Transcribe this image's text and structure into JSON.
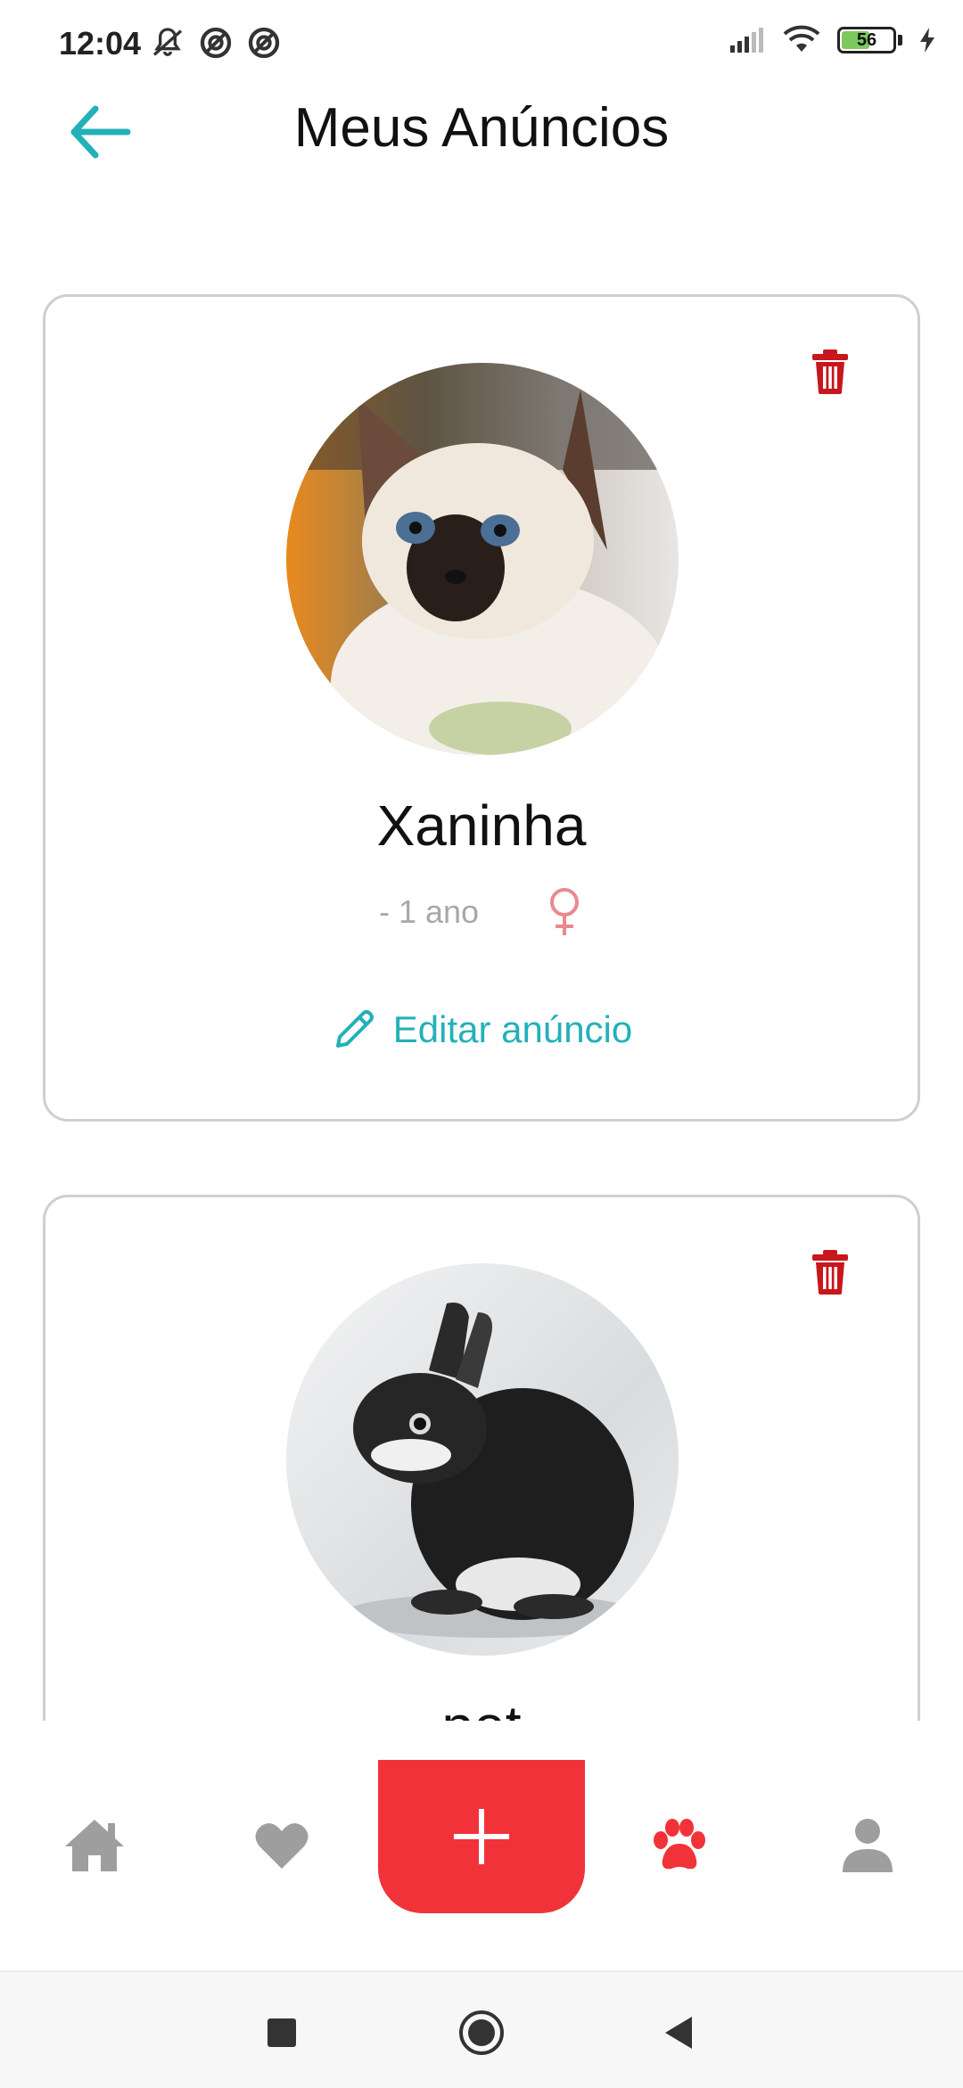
{
  "status_bar": {
    "time": "12:04",
    "battery_level": "56",
    "battery_fraction": 0.56,
    "icons": [
      "muted-bell-icon",
      "do-not-disturb-icon",
      "do-not-disturb-icon",
      "signal-icon",
      "wifi-icon",
      "battery-icon",
      "charging-icon"
    ]
  },
  "header": {
    "title": "Meus Anúncios",
    "back_icon": "arrow-left-icon"
  },
  "listings": [
    {
      "name": "Xaninha",
      "age": "- 1 ano",
      "gender_icon": "female-icon",
      "edit_label": "Editar anúncio",
      "delete_icon": "trash-icon",
      "photo": "cat-photo"
    },
    {
      "name": "pet",
      "delete_icon": "trash-icon",
      "photo": "rabbit-photo"
    }
  ],
  "bottom_nav": {
    "items": [
      "home-icon",
      "heart-icon",
      "add-icon",
      "paw-icon",
      "user-icon"
    ],
    "active": "paw-icon",
    "colors": {
      "active": "#f13339",
      "inactive": "#9e9e9e",
      "add_bg": "#f13339"
    }
  },
  "colors": {
    "accent": "#23b1b8",
    "delete": "#c8161d",
    "gender": "#e88a8f"
  },
  "system_nav": [
    "recents-icon",
    "home-circle-icon",
    "back-triangle-icon"
  ]
}
